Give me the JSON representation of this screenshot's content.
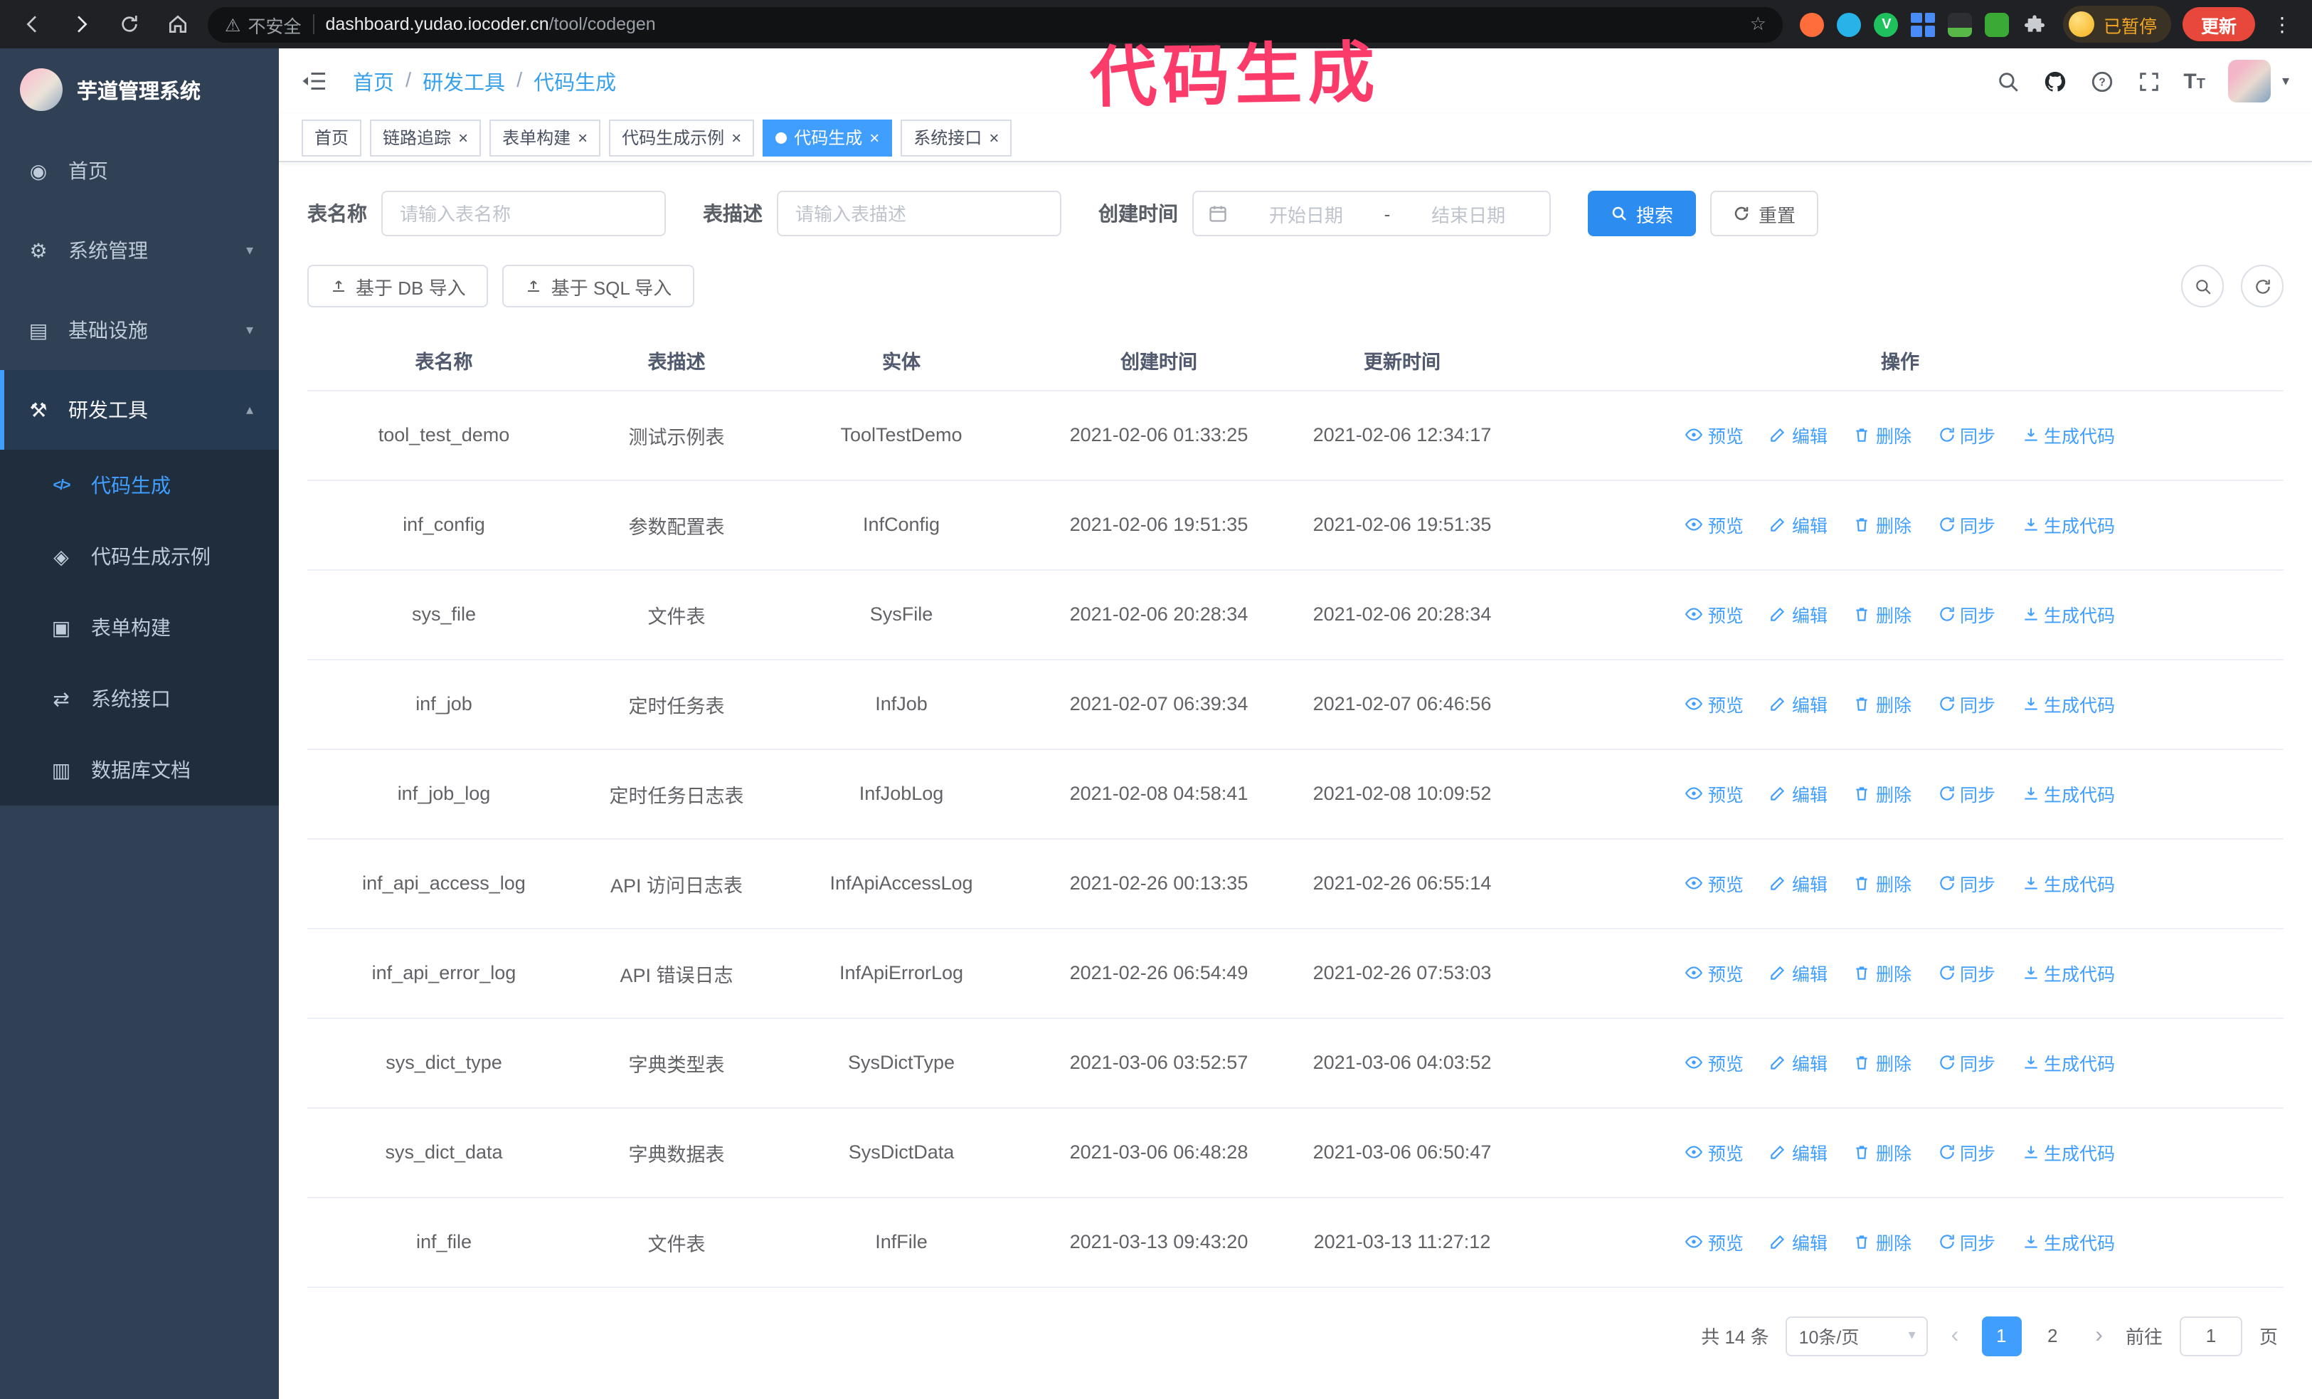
{
  "annotation": {
    "text": "代码生成",
    "color": "#fb3b69"
  },
  "colors": {
    "accent": "#409eff",
    "sidebar_bg": "#304156",
    "submenu_bg": "#1f2d3d",
    "active_tab_bg": "#409eff",
    "search_button_bg": "#2d8cf0",
    "update_pill_bg": "#e8473b",
    "paused_text": "#f5a623"
  },
  "browser": {
    "security_label": "不安全",
    "url_host": "dashboard.yudao.iocoder.cn",
    "url_path": "/tool/codegen",
    "paused_badge": "已暂停",
    "update_button": "更新"
  },
  "sidebar": {
    "logo_title": "芋道管理系统",
    "items": [
      {
        "key": "home",
        "icon": "dashboard-icon",
        "label": "首页"
      },
      {
        "key": "system",
        "icon": "gear-icon",
        "label": "系统管理",
        "expandable": true
      },
      {
        "key": "infra",
        "icon": "infra-icon",
        "label": "基础设施",
        "expandable": true
      },
      {
        "key": "devtools",
        "icon": "tools-icon",
        "label": "研发工具",
        "expandable": true,
        "expanded": true,
        "children": [
          {
            "key": "codegen",
            "icon": "code-icon",
            "label": "代码生成",
            "active": true
          },
          {
            "key": "codegen-example",
            "icon": "example-icon",
            "label": "代码生成示例"
          },
          {
            "key": "form-builder",
            "icon": "form-icon",
            "label": "表单构建"
          },
          {
            "key": "system-api",
            "icon": "api-icon",
            "label": "系统接口"
          },
          {
            "key": "db-doc",
            "icon": "db-doc-icon",
            "label": "数据库文档"
          }
        ]
      }
    ]
  },
  "header": {
    "breadcrumb": [
      "首页",
      "研发工具",
      "代码生成"
    ]
  },
  "tabs": [
    {
      "key": "home",
      "label": "首页",
      "closable": false,
      "active": false
    },
    {
      "key": "tracer",
      "label": "链路追踪",
      "closable": true,
      "active": false
    },
    {
      "key": "form-builder",
      "label": "表单构建",
      "closable": true,
      "active": false
    },
    {
      "key": "codegen-example",
      "label": "代码生成示例",
      "closable": true,
      "active": false
    },
    {
      "key": "codegen",
      "label": "代码生成",
      "closable": true,
      "active": true
    },
    {
      "key": "system-api",
      "label": "系统接口",
      "closable": true,
      "active": false
    }
  ],
  "filters": {
    "table_name_label": "表名称",
    "table_name_placeholder": "请输入表名称",
    "table_desc_label": "表描述",
    "table_desc_placeholder": "请输入表描述",
    "create_time_label": "创建时间",
    "date_start_placeholder": "开始日期",
    "date_separator": "-",
    "date_end_placeholder": "结束日期",
    "search_button": "搜索",
    "reset_button": "重置"
  },
  "toolbar": {
    "import_db_button": "基于 DB 导入",
    "import_sql_button": "基于 SQL 导入"
  },
  "table": {
    "columns": [
      "表名称",
      "表描述",
      "实体",
      "创建时间",
      "更新时间",
      "操作"
    ],
    "ops": [
      "预览",
      "编辑",
      "删除",
      "同步",
      "生成代码"
    ],
    "rows": [
      {
        "name": "tool_test_demo",
        "desc": "测试示例表",
        "entity": "ToolTestDemo",
        "created": "2021-02-06 01:33:25",
        "updated": "2021-02-06 12:34:17"
      },
      {
        "name": "inf_config",
        "desc": "参数配置表",
        "entity": "InfConfig",
        "created": "2021-02-06 19:51:35",
        "updated": "2021-02-06 19:51:35"
      },
      {
        "name": "sys_file",
        "desc": "文件表",
        "entity": "SysFile",
        "created": "2021-02-06 20:28:34",
        "updated": "2021-02-06 20:28:34"
      },
      {
        "name": "inf_job",
        "desc": "定时任务表",
        "entity": "InfJob",
        "created": "2021-02-07 06:39:34",
        "updated": "2021-02-07 06:46:56"
      },
      {
        "name": "inf_job_log",
        "desc": "定时任务日志表",
        "entity": "InfJobLog",
        "created": "2021-02-08 04:58:41",
        "updated": "2021-02-08 10:09:52"
      },
      {
        "name": "inf_api_access_log",
        "desc": "API 访问日志表",
        "entity": "InfApiAccessLog",
        "created": "2021-02-26 00:13:35",
        "updated": "2021-02-26 06:55:14"
      },
      {
        "name": "inf_api_error_log",
        "desc": "API 错误日志",
        "entity": "InfApiErrorLog",
        "created": "2021-02-26 06:54:49",
        "updated": "2021-02-26 07:53:03"
      },
      {
        "name": "sys_dict_type",
        "desc": "字典类型表",
        "entity": "SysDictType",
        "created": "2021-03-06 03:52:57",
        "updated": "2021-03-06 04:03:52"
      },
      {
        "name": "sys_dict_data",
        "desc": "字典数据表",
        "entity": "SysDictData",
        "created": "2021-03-06 06:48:28",
        "updated": "2021-03-06 06:50:47"
      },
      {
        "name": "inf_file",
        "desc": "文件表",
        "entity": "InfFile",
        "created": "2021-03-13 09:43:20",
        "updated": "2021-03-13 11:27:12"
      }
    ]
  },
  "pagination": {
    "total": "共 14 条",
    "page_size": "10条/页",
    "pages": [
      "1",
      "2"
    ],
    "active_page": "1",
    "goto_label": "前往",
    "goto_value": "1",
    "goto_suffix": "页"
  }
}
